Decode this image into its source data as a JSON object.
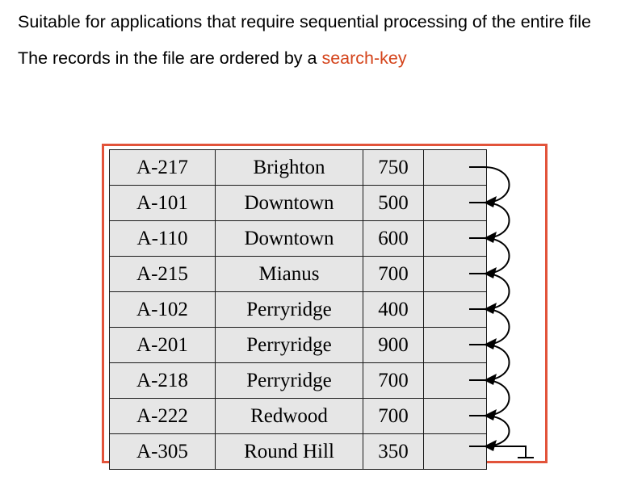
{
  "slide": {
    "bullets": [
      "Suitable for applications that require sequential processing of the entire file",
      "The records in the file are ordered by a "
    ],
    "accent_term": "search-key",
    "accent_color": "#d4431a",
    "border_color": "#e2533a"
  },
  "table": {
    "columns": [
      "account_number",
      "branch_name",
      "balance",
      "pointer"
    ],
    "rows": [
      {
        "account": "A-217",
        "branch": "Brighton",
        "balance": "750"
      },
      {
        "account": "A-101",
        "branch": "Downtown",
        "balance": "500"
      },
      {
        "account": "A-110",
        "branch": "Downtown",
        "balance": "600"
      },
      {
        "account": "A-215",
        "branch": "Mianus",
        "balance": "700"
      },
      {
        "account": "A-102",
        "branch": "Perryridge",
        "balance": "400"
      },
      {
        "account": "A-201",
        "branch": "Perryridge",
        "balance": "900"
      },
      {
        "account": "A-218",
        "branch": "Perryridge",
        "balance": "700"
      },
      {
        "account": "A-222",
        "branch": "Redwood",
        "balance": "700"
      },
      {
        "account": "A-305",
        "branch": "Round Hill",
        "balance": "350"
      }
    ]
  }
}
